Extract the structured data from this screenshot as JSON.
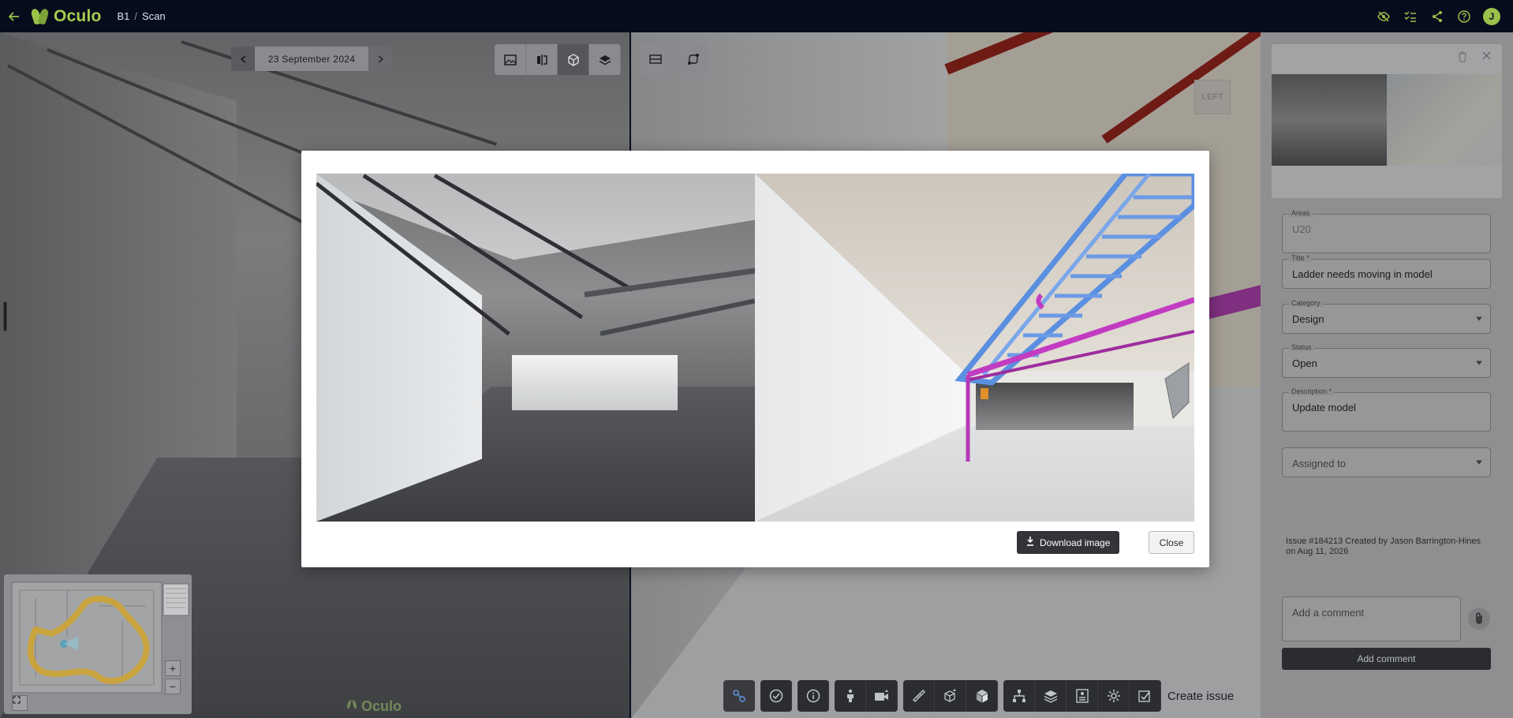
{
  "header": {
    "breadcrumb": [
      "B1",
      "Scan"
    ],
    "breadcrumb_sep": "/",
    "logo_text": "Oculo",
    "user_initial": "J",
    "icons": [
      "eye-off-icon",
      "checklist-icon",
      "share-icon",
      "help-icon"
    ]
  },
  "viewer": {
    "date_label": "23 September 2024",
    "view_tools": [
      "image-icon",
      "split-view-icon",
      "cube-icon",
      "layers-icon"
    ],
    "active_view_tool": "cube-icon",
    "model_tools": [
      "section-icon",
      "route-icon"
    ],
    "nav_cube_label": "LEFT",
    "watermark_text": "Oculo"
  },
  "minimap": {
    "zoom_in": "+",
    "zoom_out": "−"
  },
  "bottom_toolbar": {
    "groups": [
      [
        "issues-icon"
      ],
      [
        "check-icon"
      ],
      [
        "info-icon"
      ],
      [
        "person-icon",
        "camera-icon"
      ],
      [
        "measure-icon",
        "cube-box-icon",
        "cube-solid-icon"
      ],
      [
        "tree-icon",
        "layers-stack-icon",
        "properties-icon",
        "settings-icon"
      ]
    ],
    "create_issue_label": "Create issue"
  },
  "issue_panel": {
    "areas": {
      "label": "Areas",
      "value": "U20"
    },
    "title": {
      "label": "Title *",
      "value": "Ladder needs moving in model"
    },
    "category": {
      "label": "Category",
      "value": "Design"
    },
    "status": {
      "label": "Status",
      "value": "Open"
    },
    "description": {
      "label": "Description *",
      "value": "Update model"
    },
    "assigned_to": {
      "placeholder": "Assigned to"
    },
    "meta_text": "Issue #184213 Created by Jason Barrington-Hines on Aug 11, 2026",
    "comment_placeholder": "Add a comment",
    "add_comment_label": "Add comment"
  },
  "modal": {
    "download_label": "Download image",
    "close_label": "Close"
  },
  "colors": {
    "brand_green": "#9ac14a",
    "topbar_bg": "#070c1c",
    "dark_button": "#333438",
    "model_ladder": "#5b8fe0",
    "model_pipe": "#c23cc2"
  }
}
